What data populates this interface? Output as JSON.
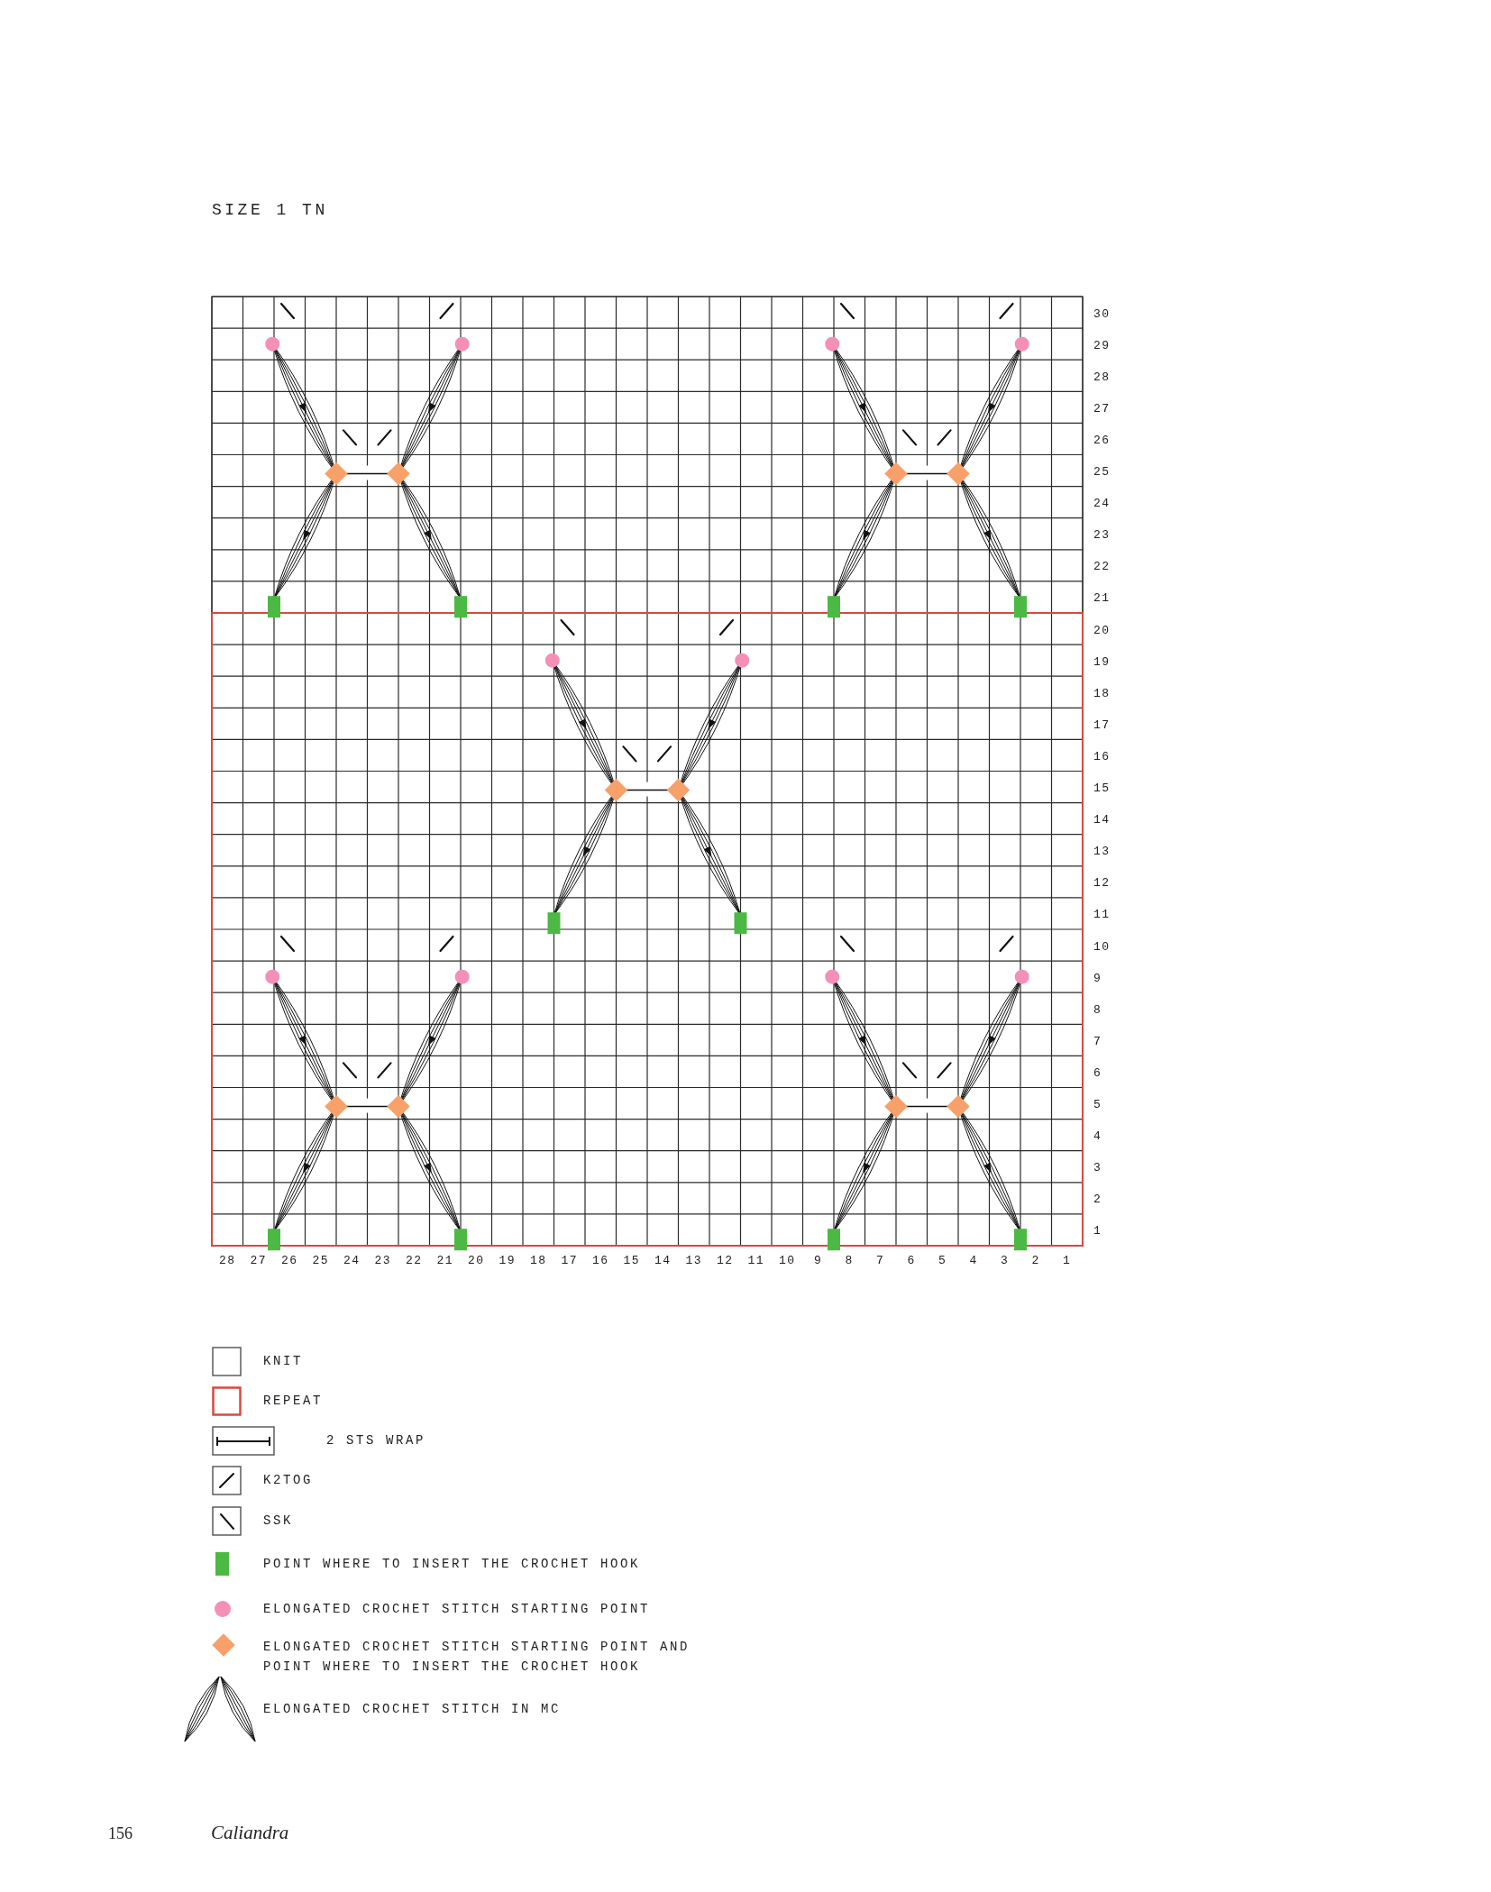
{
  "title": "SIZE 1 TN",
  "chart": {
    "row_labels": [
      "30",
      "29",
      "28",
      "27",
      "26",
      "25",
      "24",
      "23",
      "22",
      "21",
      "20",
      "19",
      "18",
      "17",
      "16",
      "15",
      "14",
      "13",
      "12",
      "11",
      "10",
      "9",
      "8",
      "7",
      "6",
      "5",
      "4",
      "3",
      "2",
      "1"
    ],
    "column_labels": [
      "28",
      "27",
      "26",
      "25",
      "24",
      "23",
      "22",
      "21",
      "20",
      "19",
      "18",
      "17",
      "16",
      "15",
      "14",
      "13",
      "12",
      "11",
      "10",
      "9",
      "8",
      "7",
      "6",
      "5",
      "4",
      "3",
      "2",
      "1"
    ]
  },
  "legend": [
    {
      "kind": "knit",
      "label": "KNIT"
    },
    {
      "kind": "repeat",
      "label": "REPEAT"
    },
    {
      "kind": "wrap",
      "label": "2 STS WRAP"
    },
    {
      "kind": "k2tog",
      "label": "K2TOG"
    },
    {
      "kind": "ssk",
      "label": "SSK"
    },
    {
      "kind": "hook_point",
      "label": "POINT WHERE TO INSERT THE CROCHET HOOK"
    },
    {
      "kind": "start_point",
      "label": "ELONGATED CROCHET STITCH STARTING POINT"
    },
    {
      "kind": "start_and_hook",
      "label": "ELONGATED CROCHET STITCH STARTING POINT AND POINT WHERE TO INSERT THE CROCHET HOOK"
    },
    {
      "kind": "elongated_stitch",
      "label": "ELONGATED CROCHET STITCH IN MC"
    }
  ],
  "footer": {
    "page_number": "156",
    "book_title": "Caliandra"
  }
}
